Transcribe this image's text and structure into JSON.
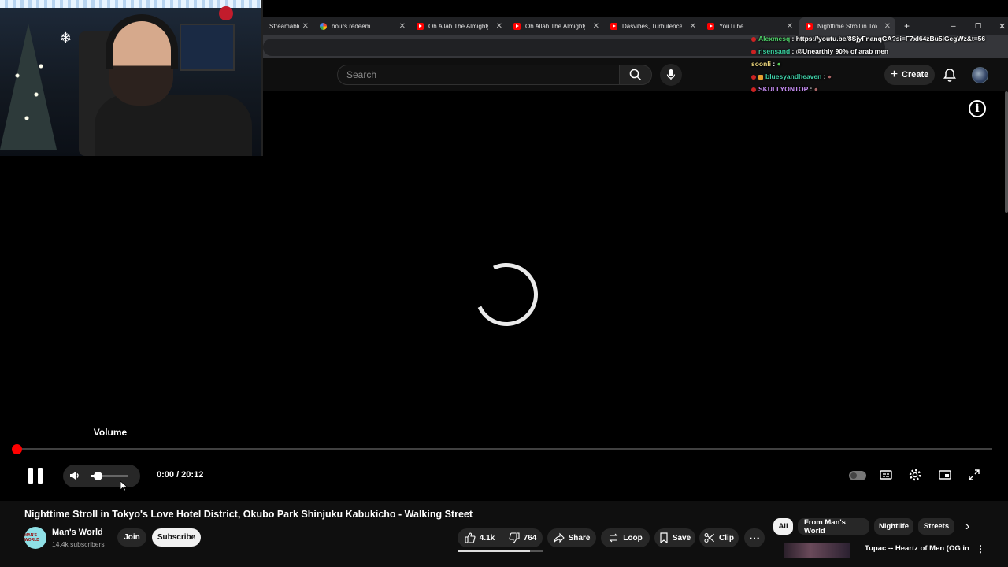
{
  "browser": {
    "tabs": [
      {
        "title": "Streamable",
        "favicon": "none"
      },
      {
        "title": "hours redeem",
        "favicon": "google"
      },
      {
        "title": "Oh Allah The Almighty",
        "favicon": "youtube"
      },
      {
        "title": "Oh Allah The Almighty",
        "favicon": "youtube"
      },
      {
        "title": "Dasvibes, Turbulence",
        "favicon": "youtube"
      },
      {
        "title": "YouTube",
        "favicon": "youtube"
      },
      {
        "title": "Nighttime Stroll in Tokyo",
        "favicon": "youtube",
        "active": true
      }
    ],
    "new_tab_icon": "plus-icon",
    "window_controls": [
      "minimize-icon",
      "restore-icon",
      "close-icon"
    ]
  },
  "header": {
    "search_placeholder": "Search",
    "create_label": "Create"
  },
  "player": {
    "volume_tooltip": "Volume",
    "current_time": "0:00",
    "duration": "20:12",
    "time_display": "0:00 / 20:12",
    "progress_fraction": 0.0,
    "volume_fraction": 0.15,
    "loading": true
  },
  "video": {
    "title": "Nighttime Stroll in Tokyo's Love Hotel District, Okubo Park Shinjuku Kabukicho - Walking Street",
    "channel_name": "Man's World",
    "subscribers": "14.4k subscribers",
    "channel_avatar_text": "MAN'S WORLD",
    "join_label": "Join",
    "subscribe_label": "Subscribe",
    "likes": "4.1k",
    "dislikes": "764",
    "share_label": "Share",
    "loop_label": "Loop",
    "save_label": "Save",
    "clip_label": "Clip"
  },
  "chips": [
    "All",
    "From Man's World",
    "Nightlife",
    "Streets"
  ],
  "related": {
    "title": "Tupac -- Heartz of Men (OG in"
  },
  "chat": [
    {
      "user": "Alexmesq",
      "color": "#4fd26a",
      "message": "https://youtu.be/8SjyFnanqGA?si=F7xl64zBu5iGegWz&t=56"
    },
    {
      "user": "risensand",
      "color": "#3ad2a0",
      "message": "@Unearthly 90% of arab men"
    },
    {
      "user": "soonli",
      "color": "#e8d27a",
      "message": ""
    },
    {
      "user": "bluesyandheaven",
      "color": "#3fd0a8",
      "message": ""
    },
    {
      "user": "SKULLYONTOP",
      "color": "#c58cf2",
      "message": ""
    }
  ]
}
